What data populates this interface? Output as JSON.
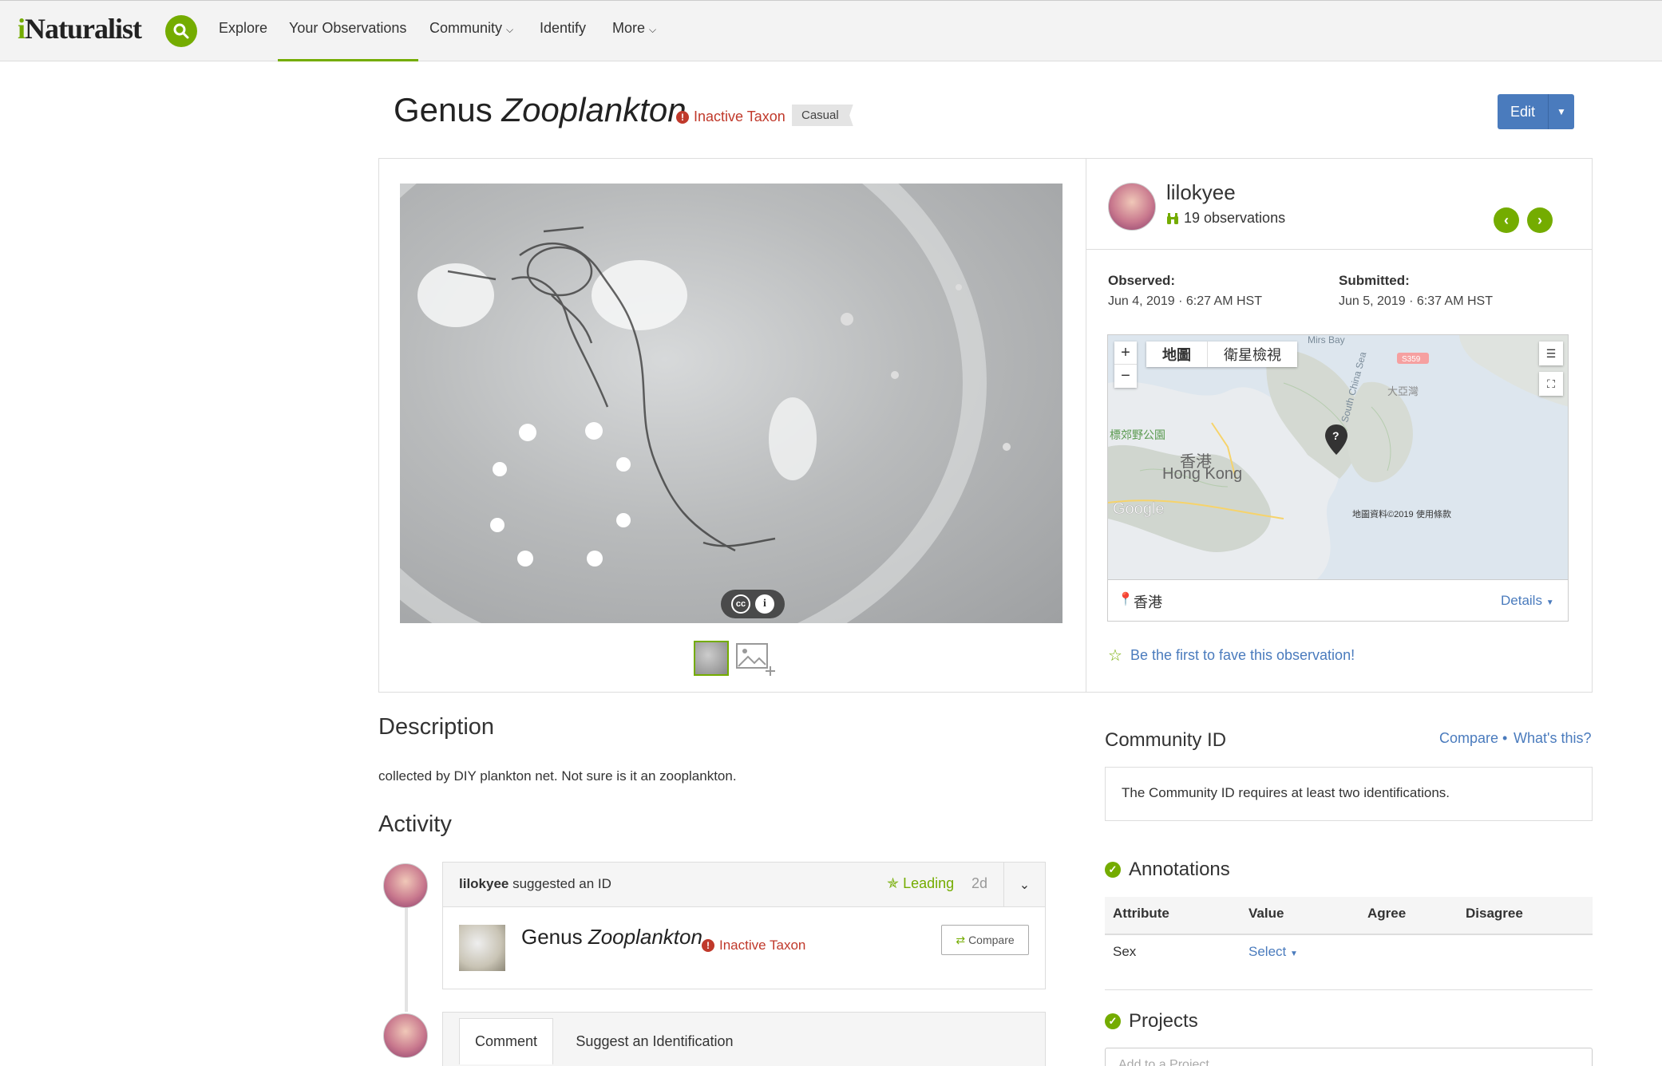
{
  "header": {
    "logo": "iNaturalist",
    "nav": [
      "Explore",
      "Your Observations",
      "Community",
      "Identify",
      "More"
    ]
  },
  "title": {
    "rank": "Genus",
    "name": "Zooplankton",
    "status": "Inactive Taxon",
    "quality": "Casual",
    "edit_label": "Edit"
  },
  "observer": {
    "username": "lilokyee",
    "obs_count": "19 observations"
  },
  "dates": {
    "observed_label": "Observed:",
    "observed": "Jun 4, 2019 · 6:27 AM HST",
    "submitted_label": "Submitted:",
    "submitted": "Jun 5, 2019 · 6:37 AM HST"
  },
  "map": {
    "type_map": "地圖",
    "type_satellite": "衛星檢視",
    "labels": {
      "mirs_bay": "Mirs Bay",
      "south_china_sea": "South China Sea",
      "hk_zh": "香港",
      "hk_en": "Hong Kong",
      "park": "標郊野公園",
      "tai_a": "大亞灣",
      "road": "S359",
      "google": "Google",
      "copyright": "地圖資料©2019",
      "terms": "使用條款"
    },
    "place": "香港",
    "details": "Details"
  },
  "fave": "Be the first to fave this observation!",
  "description": {
    "heading": "Description",
    "text": "collected by DIY plankton net. Not sure is it an zooplankton."
  },
  "activity": {
    "heading": "Activity",
    "item": {
      "user": "lilokyee",
      "action": " suggested an ID",
      "leading": "Leading",
      "age": "2d",
      "rank": "Genus",
      "name": "Zooplankton",
      "status": "Inactive Taxon",
      "compare": "Compare"
    },
    "tabs": [
      "Comment",
      "Suggest an Identification"
    ]
  },
  "community_id": {
    "heading": "Community ID",
    "compare": "Compare",
    "whats_this": "What's this?",
    "message": "The Community ID requires at least two identifications."
  },
  "annotations": {
    "heading": "Annotations",
    "columns": [
      "Attribute",
      "Value",
      "Agree",
      "Disagree"
    ],
    "rows": [
      {
        "attribute": "Sex",
        "value": "Select"
      }
    ]
  },
  "projects": {
    "heading": "Projects",
    "placeholder": "Add to a Project"
  },
  "colors": {
    "brand_green": "#74ac00",
    "link_blue": "#4a7bbd",
    "inactive_red": "#c0392b"
  }
}
